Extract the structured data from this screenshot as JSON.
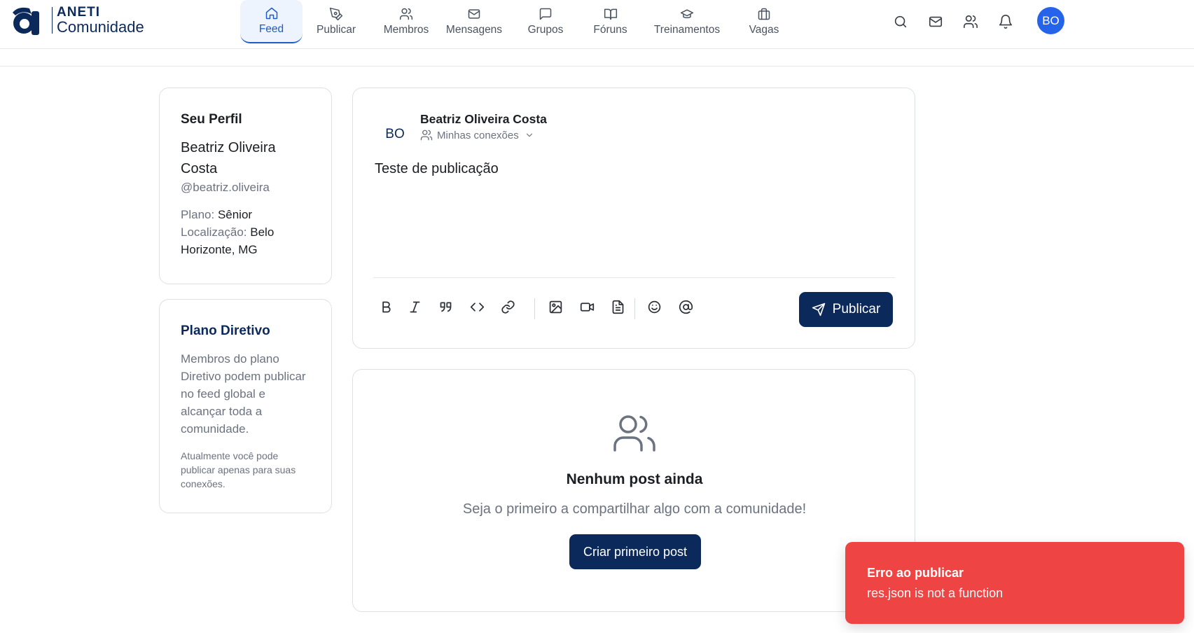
{
  "header": {
    "logo": {
      "mark": "a",
      "brand": "ANETI",
      "sub": "Comunidade"
    },
    "nav": [
      {
        "label": "Feed",
        "icon": "home-icon",
        "active": true
      },
      {
        "label": "Publicar",
        "icon": "pen-tool-icon",
        "active": false
      },
      {
        "label": "Membros",
        "icon": "users-icon",
        "active": false
      },
      {
        "label": "Mensagens",
        "icon": "mail-icon",
        "active": false
      },
      {
        "label": "Grupos",
        "icon": "message-square-icon",
        "active": false
      },
      {
        "label": "Fóruns",
        "icon": "book-open-icon",
        "active": false
      },
      {
        "label": "Treinamentos",
        "icon": "graduation-cap-icon",
        "active": false
      },
      {
        "label": "Vagas",
        "icon": "briefcase-icon",
        "active": false
      }
    ],
    "right_icons": [
      "search-icon",
      "mail-icon",
      "users-icon",
      "bell-icon"
    ],
    "avatar_initials": "BO"
  },
  "profile_card": {
    "title": "Seu Perfil",
    "name": "Beatriz Oliveira Costa",
    "handle": "@beatriz.oliveira",
    "plan_label": "Plano:",
    "plan_value": "Sênior",
    "location_label": "Localização:",
    "location_value": "Belo Horizonte, MG"
  },
  "plan_card": {
    "title": "Plano Diretivo",
    "description": "Membros do plano Diretivo podem publicar no feed global e alcançar toda a comunidade.",
    "note": "Atualmente você pode publicar apenas para suas conexões."
  },
  "composer": {
    "avatar_initials": "BO",
    "author": "Beatriz Oliveira Costa",
    "visibility": "Minhas conexões",
    "text": "Teste de publicação",
    "toolbar": [
      "bold-icon",
      "italic-icon",
      "quote-icon",
      "code-icon",
      "link-icon",
      "image-icon",
      "video-icon",
      "file-text-icon",
      "smile-icon",
      "at-sign-icon"
    ],
    "publish_label": "Publicar"
  },
  "empty_state": {
    "icon": "users-icon",
    "title": "Nenhum post ainda",
    "subtitle": "Seja o primeiro a compartilhar algo com a comunidade!",
    "button": "Criar primeiro post"
  },
  "toast": {
    "title": "Erro ao publicar",
    "message": "res.json is not a function",
    "color": "#ef4444"
  },
  "colors": {
    "primary": "#0b2a5b",
    "accent": "#1e5bc6",
    "avatar": "#2563eb"
  }
}
